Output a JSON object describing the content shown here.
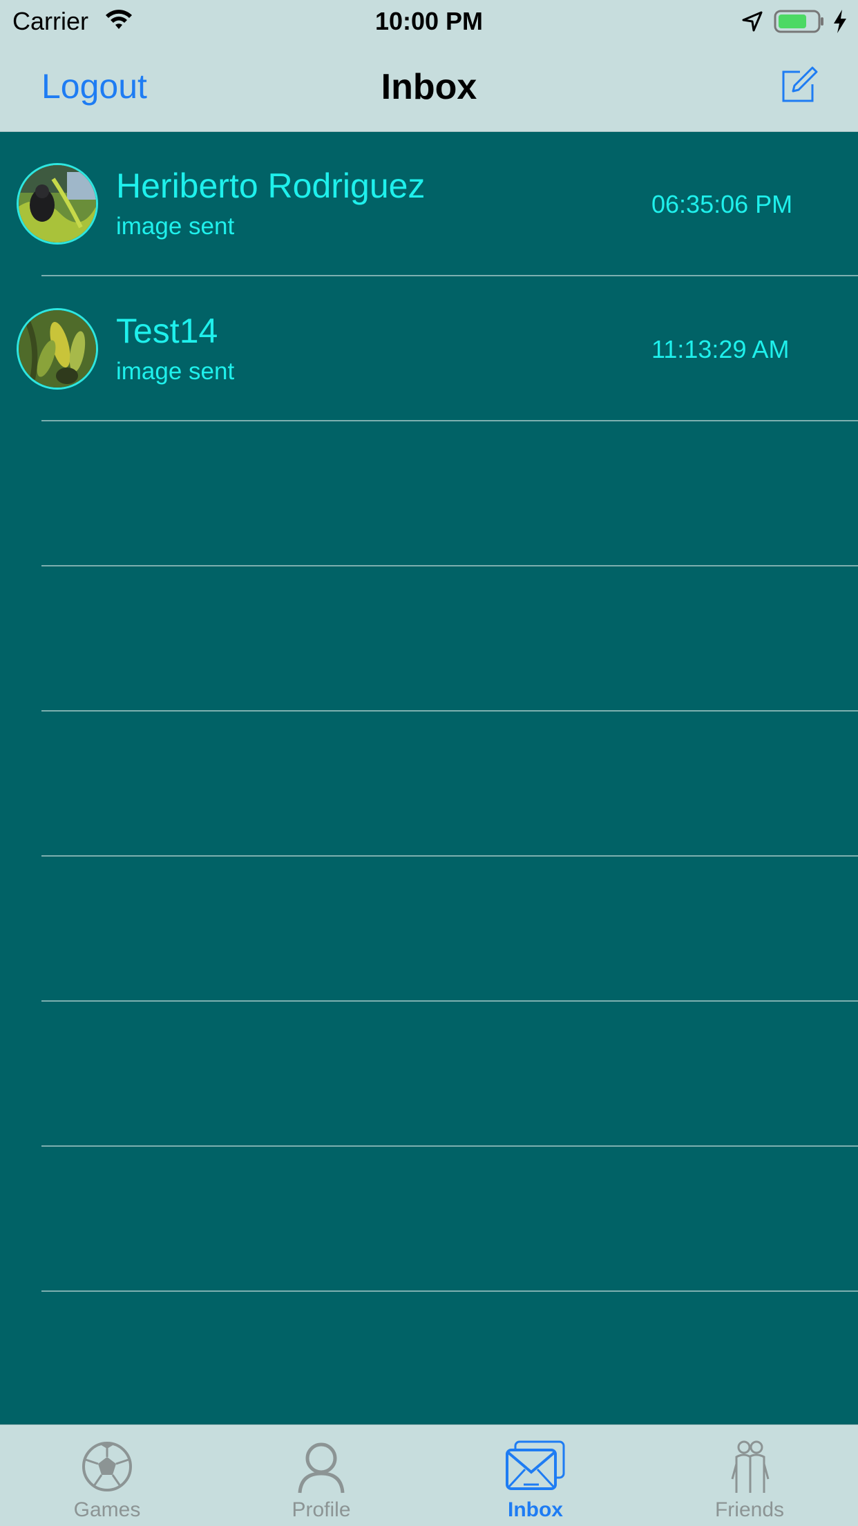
{
  "status_bar": {
    "carrier": "Carrier",
    "time": "10:00 PM",
    "battery_color": "#4cd964"
  },
  "nav": {
    "logout_label": "Logout",
    "title": "Inbox",
    "compose_icon": "compose-icon"
  },
  "messages": [
    {
      "name": "Heriberto Rodriguez",
      "preview": "image sent",
      "time": "06:35:06 PM",
      "avatar": "photo of gorilla in grass"
    },
    {
      "name": "Test14",
      "preview": "image sent",
      "time": "11:13:29 AM",
      "avatar": "photo of green leaves"
    }
  ],
  "tabs": [
    {
      "label": "Games",
      "icon": "soccer-ball-icon",
      "active": false
    },
    {
      "label": "Profile",
      "icon": "person-icon",
      "active": false
    },
    {
      "label": "Inbox",
      "icon": "mail-icon",
      "active": true
    },
    {
      "label": "Friends",
      "icon": "people-icon",
      "active": false
    }
  ],
  "colors": {
    "background": "#016266",
    "header": "#c7dddd",
    "accent_text": "#1ff0ec",
    "tint": "#1e7cf3",
    "inactive_tab": "#8c9494"
  }
}
